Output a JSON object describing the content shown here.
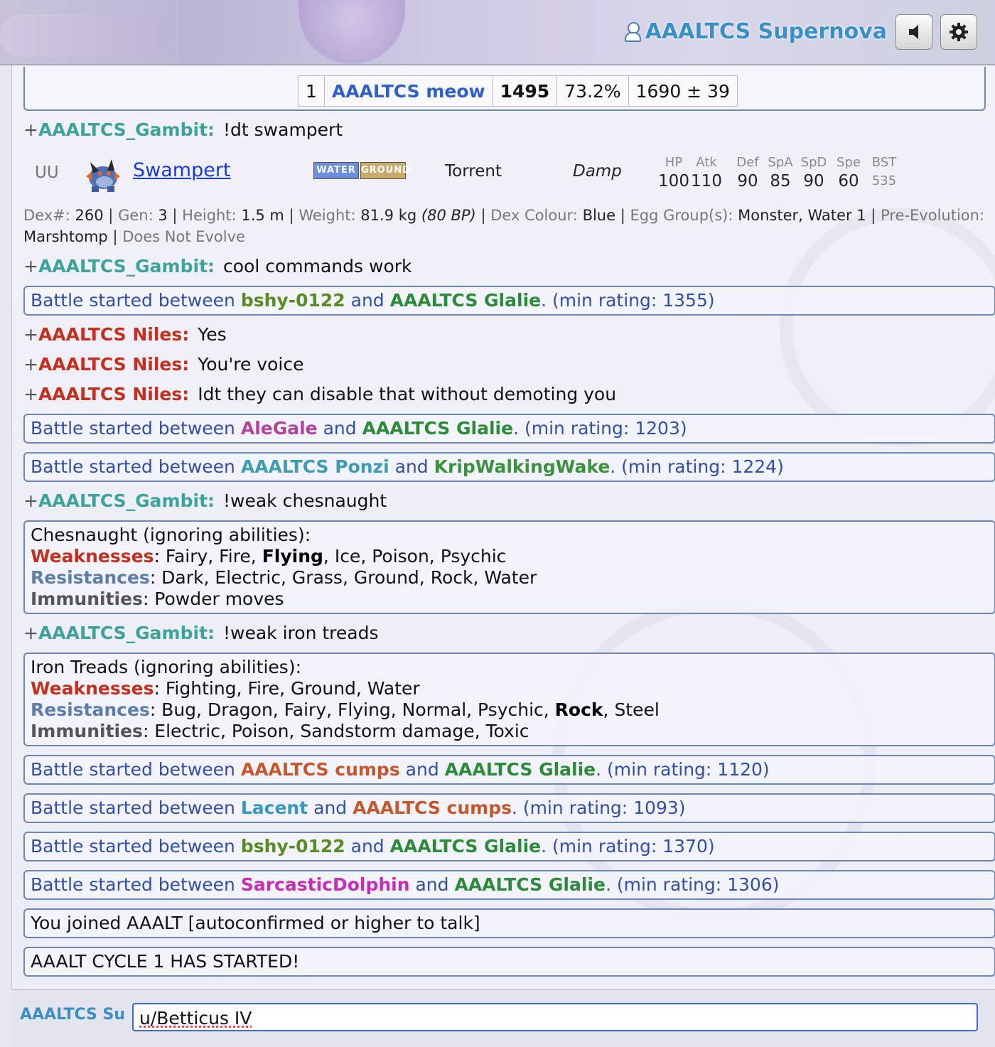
{
  "header": {
    "username": "AAALTCS Supernova",
    "sound_icon": "speaker-icon",
    "settings_icon": "gear-icon"
  },
  "rank_row": {
    "rank": "1",
    "name": "AAALTCS meow",
    "elo": "1495",
    "gxe": "73.2%",
    "glicko": "1690 ± 39"
  },
  "messages": {
    "m1": {
      "prefix": "+",
      "user": "AAALTCS_Gambit:",
      "text": "!dt swampert"
    },
    "m2": {
      "prefix": "+",
      "user": "AAALTCS_Gambit:",
      "text": "cool commands work"
    },
    "m3": {
      "prefix": "+",
      "user": "AAALTCS Niles:",
      "text": "Yes"
    },
    "m4": {
      "prefix": "+",
      "user": "AAALTCS Niles:",
      "text": "You're voice"
    },
    "m5": {
      "prefix": "+",
      "user": "AAALTCS Niles:",
      "text": "Idt they can disable that without demoting you"
    },
    "m6": {
      "prefix": "+",
      "user": "AAALTCS_Gambit:",
      "text": "!weak chesnaught"
    },
    "m7": {
      "prefix": "+",
      "user": "AAALTCS_Gambit:",
      "text": "!weak iron treads"
    }
  },
  "pokemon": {
    "tier": "UU",
    "name": "Swampert",
    "types": [
      "WATER",
      "GROUND"
    ],
    "ability": "Torrent",
    "hidden_ability": "Damp",
    "stat_labels": [
      "HP",
      "Atk",
      "Def",
      "SpA",
      "SpD",
      "Spe",
      "BST"
    ],
    "stat_values": [
      "100",
      "110",
      "90",
      "85",
      "90",
      "60",
      "535"
    ],
    "dex": {
      "dex_label": "Dex#:",
      "dex_value": "260",
      "gen_label": "Gen:",
      "gen_value": "3",
      "height_label": "Height:",
      "height_value": "1.5 m",
      "weight_label": "Weight:",
      "weight_value": "81.9 kg",
      "weight_bp": "(80 BP)",
      "colour_label": "Dex Colour:",
      "colour_value": "Blue",
      "egg_label": "Egg Group(s):",
      "egg_value": "Monster, Water 1",
      "pre_label": "Pre-Evolution:",
      "pre_value": "Marshtomp",
      "evolve": "Does Not Evolve"
    }
  },
  "battles": {
    "b1": {
      "lead": "Battle started between",
      "p1": "bshy-0122",
      "and": "and",
      "p2": "AAALTCS Glalie",
      "rating": ". (min rating: 1355)"
    },
    "b2": {
      "lead": "Battle started between",
      "p1": "AleGale",
      "and": "and",
      "p2": "AAALTCS Glalie",
      "rating": ". (min rating: 1203)"
    },
    "b3": {
      "lead": "Battle started between",
      "p1": "AAALTCS Ponzi",
      "and": "and",
      "p2": "KripWalkingWake",
      "rating": ". (min rating: 1224)"
    },
    "b4": {
      "lead": "Battle started between",
      "p1": "AAALTCS cumps",
      "and": "and",
      "p2": "AAALTCS Glalie",
      "rating": ". (min rating: 1120)"
    },
    "b5": {
      "lead": "Battle started between",
      "p1": "Lacent",
      "and": "and",
      "p2": "AAALTCS cumps",
      "rating": ". (min rating: 1093)"
    },
    "b6": {
      "lead": "Battle started between",
      "p1": "bshy-0122",
      "and": "and",
      "p2": "AAALTCS Glalie",
      "rating": ". (min rating: 1370)"
    },
    "b7": {
      "lead": "Battle started between",
      "p1": "SarcasticDolphin",
      "and": "and",
      "p2": "AAALTCS Glalie",
      "rating": ". (min rating: 1306)"
    }
  },
  "weak1": {
    "title": "Chesnaught (ignoring abilities):",
    "w_label": "Weaknesses",
    "w_a": ": Fairy, Fire, ",
    "w_b": "Flying",
    "w_c": ", Ice, Poison, Psychic",
    "r_label": "Resistances",
    "r_text": ": Dark, Electric, Grass, Ground, Rock, Water",
    "i_label": "Immunities",
    "i_text": ": Powder moves"
  },
  "weak2": {
    "title": "Iron Treads (ignoring abilities):",
    "w_label": "Weaknesses",
    "w_text": ": Fighting, Fire, Ground, Water",
    "r_label": "Resistances",
    "r_a": ": Bug, Dragon, Fairy, Flying, Normal, Psychic, ",
    "r_b": "Rock",
    "r_c": ", Steel",
    "i_label": "Immunities",
    "i_text": ": Electric, Poison, Sandstorm damage, Toxic"
  },
  "system": {
    "joined": "You joined AAALT [autoconfirmed or higher to talk]",
    "cycle": "AAALT CYCLE 1 HAS STARTED!"
  },
  "footer": {
    "room_user": "AAALTCS Su",
    "input_value": "u/Betticus IV"
  }
}
